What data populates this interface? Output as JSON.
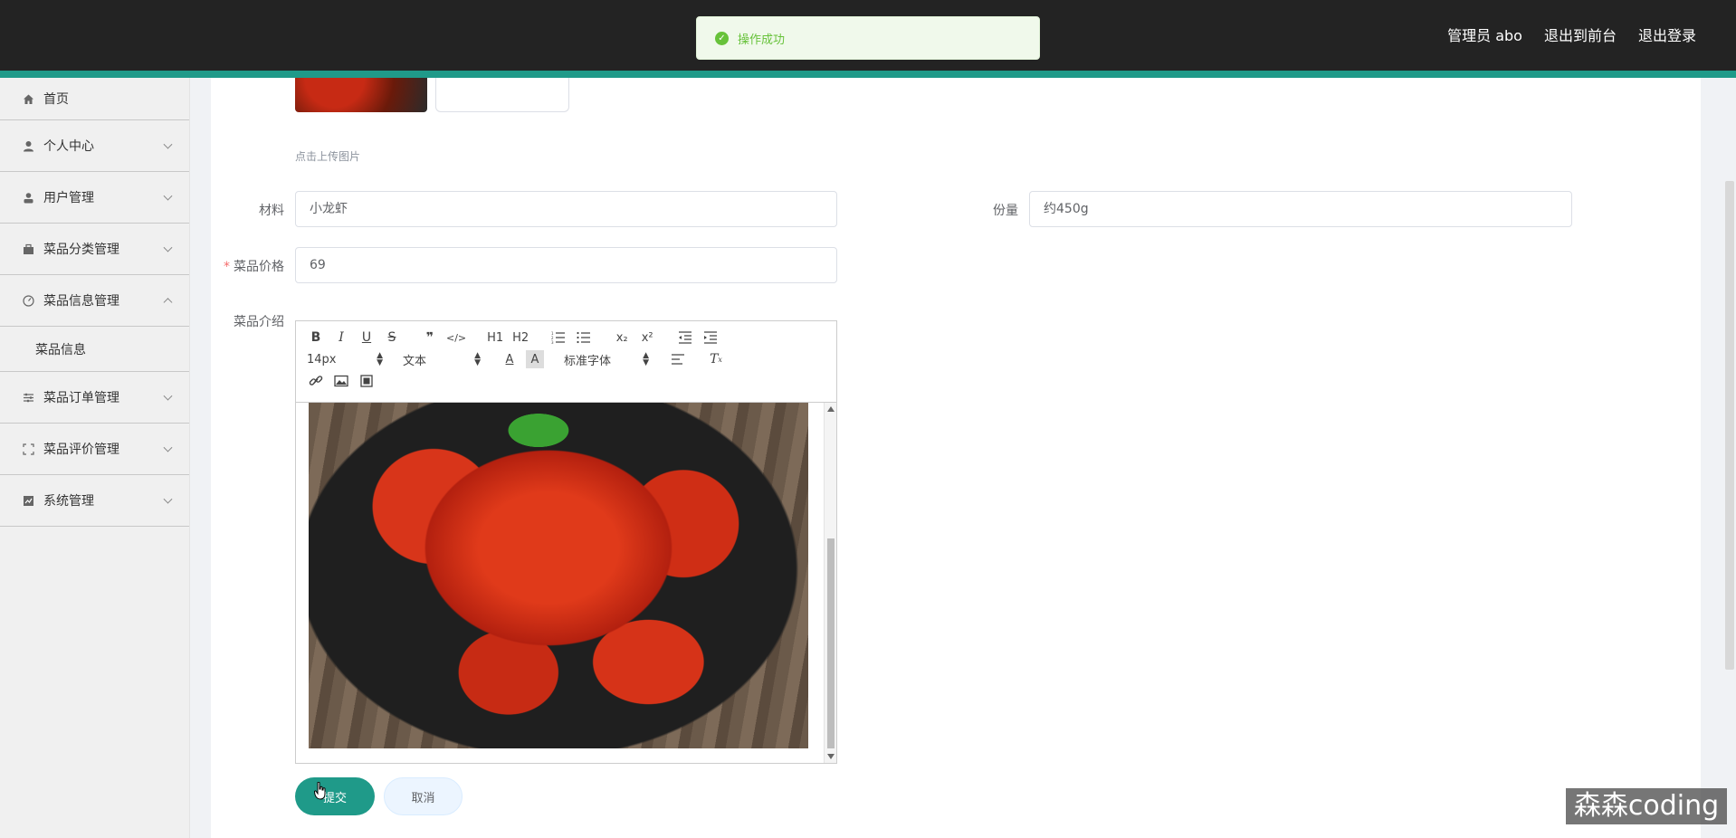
{
  "header": {
    "user_label": "管理员 abo",
    "to_front_label": "退出到前台",
    "logout_label": "退出登录"
  },
  "toast": {
    "text": "操作成功",
    "color": "#67c23a"
  },
  "sidebar": {
    "items": [
      {
        "label": "首页",
        "icon": "home-icon"
      },
      {
        "label": "个人中心",
        "icon": "user-icon"
      },
      {
        "label": "用户管理",
        "icon": "user-manage-icon"
      },
      {
        "label": "菜品分类管理",
        "icon": "category-icon"
      },
      {
        "label": "菜品信息管理",
        "icon": "dish-info-icon",
        "expanded": true,
        "children": [
          {
            "label": "菜品信息"
          }
        ]
      },
      {
        "label": "菜品订单管理",
        "icon": "order-icon"
      },
      {
        "label": "菜品评价管理",
        "icon": "review-icon"
      },
      {
        "label": "系统管理",
        "icon": "system-icon"
      }
    ]
  },
  "form": {
    "upload_hint": "点击上传图片",
    "material": {
      "label": "材料",
      "value": "小龙虾"
    },
    "portion": {
      "label": "份量",
      "value": "约450g"
    },
    "price": {
      "label": "菜品价格",
      "value": "69",
      "required_mark": "*"
    },
    "intro": {
      "label": "菜品介绍"
    }
  },
  "editor": {
    "font_size": "14px",
    "header_type": "文本",
    "font_family": "标准字体",
    "h1": "H1",
    "h2": "H2"
  },
  "buttons": {
    "submit_label": "提交",
    "cancel_label": "取消"
  },
  "watermark": "森森coding",
  "colors": {
    "accent": "#1f9a89",
    "header_bg": "#232323"
  }
}
